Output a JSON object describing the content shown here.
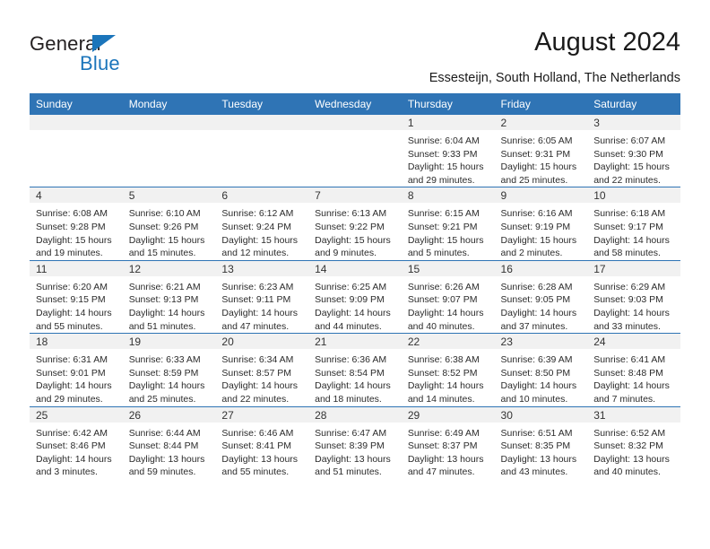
{
  "brand": {
    "name_part1": "General",
    "name_part2": "Blue",
    "accent_color": "#1b75bb"
  },
  "header": {
    "title": "August 2024",
    "subtitle": "Essesteijn, South Holland, The Netherlands"
  },
  "theme": {
    "header_row_bg": "#2f74b5",
    "daynum_bg": "#f1f1f1",
    "grid_line": "#2f74b5"
  },
  "weekdays": [
    "Sunday",
    "Monday",
    "Tuesday",
    "Wednesday",
    "Thursday",
    "Friday",
    "Saturday"
  ],
  "weeks": [
    [
      {
        "day": "",
        "sunrise": "",
        "sunset": "",
        "daylight1": "",
        "daylight2": ""
      },
      {
        "day": "",
        "sunrise": "",
        "sunset": "",
        "daylight1": "",
        "daylight2": ""
      },
      {
        "day": "",
        "sunrise": "",
        "sunset": "",
        "daylight1": "",
        "daylight2": ""
      },
      {
        "day": "",
        "sunrise": "",
        "sunset": "",
        "daylight1": "",
        "daylight2": ""
      },
      {
        "day": "1",
        "sunrise": "Sunrise: 6:04 AM",
        "sunset": "Sunset: 9:33 PM",
        "daylight1": "Daylight: 15 hours",
        "daylight2": "and 29 minutes."
      },
      {
        "day": "2",
        "sunrise": "Sunrise: 6:05 AM",
        "sunset": "Sunset: 9:31 PM",
        "daylight1": "Daylight: 15 hours",
        "daylight2": "and 25 minutes."
      },
      {
        "day": "3",
        "sunrise": "Sunrise: 6:07 AM",
        "sunset": "Sunset: 9:30 PM",
        "daylight1": "Daylight: 15 hours",
        "daylight2": "and 22 minutes."
      }
    ],
    [
      {
        "day": "4",
        "sunrise": "Sunrise: 6:08 AM",
        "sunset": "Sunset: 9:28 PM",
        "daylight1": "Daylight: 15 hours",
        "daylight2": "and 19 minutes."
      },
      {
        "day": "5",
        "sunrise": "Sunrise: 6:10 AM",
        "sunset": "Sunset: 9:26 PM",
        "daylight1": "Daylight: 15 hours",
        "daylight2": "and 15 minutes."
      },
      {
        "day": "6",
        "sunrise": "Sunrise: 6:12 AM",
        "sunset": "Sunset: 9:24 PM",
        "daylight1": "Daylight: 15 hours",
        "daylight2": "and 12 minutes."
      },
      {
        "day": "7",
        "sunrise": "Sunrise: 6:13 AM",
        "sunset": "Sunset: 9:22 PM",
        "daylight1": "Daylight: 15 hours",
        "daylight2": "and 9 minutes."
      },
      {
        "day": "8",
        "sunrise": "Sunrise: 6:15 AM",
        "sunset": "Sunset: 9:21 PM",
        "daylight1": "Daylight: 15 hours",
        "daylight2": "and 5 minutes."
      },
      {
        "day": "9",
        "sunrise": "Sunrise: 6:16 AM",
        "sunset": "Sunset: 9:19 PM",
        "daylight1": "Daylight: 15 hours",
        "daylight2": "and 2 minutes."
      },
      {
        "day": "10",
        "sunrise": "Sunrise: 6:18 AM",
        "sunset": "Sunset: 9:17 PM",
        "daylight1": "Daylight: 14 hours",
        "daylight2": "and 58 minutes."
      }
    ],
    [
      {
        "day": "11",
        "sunrise": "Sunrise: 6:20 AM",
        "sunset": "Sunset: 9:15 PM",
        "daylight1": "Daylight: 14 hours",
        "daylight2": "and 55 minutes."
      },
      {
        "day": "12",
        "sunrise": "Sunrise: 6:21 AM",
        "sunset": "Sunset: 9:13 PM",
        "daylight1": "Daylight: 14 hours",
        "daylight2": "and 51 minutes."
      },
      {
        "day": "13",
        "sunrise": "Sunrise: 6:23 AM",
        "sunset": "Sunset: 9:11 PM",
        "daylight1": "Daylight: 14 hours",
        "daylight2": "and 47 minutes."
      },
      {
        "day": "14",
        "sunrise": "Sunrise: 6:25 AM",
        "sunset": "Sunset: 9:09 PM",
        "daylight1": "Daylight: 14 hours",
        "daylight2": "and 44 minutes."
      },
      {
        "day": "15",
        "sunrise": "Sunrise: 6:26 AM",
        "sunset": "Sunset: 9:07 PM",
        "daylight1": "Daylight: 14 hours",
        "daylight2": "and 40 minutes."
      },
      {
        "day": "16",
        "sunrise": "Sunrise: 6:28 AM",
        "sunset": "Sunset: 9:05 PM",
        "daylight1": "Daylight: 14 hours",
        "daylight2": "and 37 minutes."
      },
      {
        "day": "17",
        "sunrise": "Sunrise: 6:29 AM",
        "sunset": "Sunset: 9:03 PM",
        "daylight1": "Daylight: 14 hours",
        "daylight2": "and 33 minutes."
      }
    ],
    [
      {
        "day": "18",
        "sunrise": "Sunrise: 6:31 AM",
        "sunset": "Sunset: 9:01 PM",
        "daylight1": "Daylight: 14 hours",
        "daylight2": "and 29 minutes."
      },
      {
        "day": "19",
        "sunrise": "Sunrise: 6:33 AM",
        "sunset": "Sunset: 8:59 PM",
        "daylight1": "Daylight: 14 hours",
        "daylight2": "and 25 minutes."
      },
      {
        "day": "20",
        "sunrise": "Sunrise: 6:34 AM",
        "sunset": "Sunset: 8:57 PM",
        "daylight1": "Daylight: 14 hours",
        "daylight2": "and 22 minutes."
      },
      {
        "day": "21",
        "sunrise": "Sunrise: 6:36 AM",
        "sunset": "Sunset: 8:54 PM",
        "daylight1": "Daylight: 14 hours",
        "daylight2": "and 18 minutes."
      },
      {
        "day": "22",
        "sunrise": "Sunrise: 6:38 AM",
        "sunset": "Sunset: 8:52 PM",
        "daylight1": "Daylight: 14 hours",
        "daylight2": "and 14 minutes."
      },
      {
        "day": "23",
        "sunrise": "Sunrise: 6:39 AM",
        "sunset": "Sunset: 8:50 PM",
        "daylight1": "Daylight: 14 hours",
        "daylight2": "and 10 minutes."
      },
      {
        "day": "24",
        "sunrise": "Sunrise: 6:41 AM",
        "sunset": "Sunset: 8:48 PM",
        "daylight1": "Daylight: 14 hours",
        "daylight2": "and 7 minutes."
      }
    ],
    [
      {
        "day": "25",
        "sunrise": "Sunrise: 6:42 AM",
        "sunset": "Sunset: 8:46 PM",
        "daylight1": "Daylight: 14 hours",
        "daylight2": "and 3 minutes."
      },
      {
        "day": "26",
        "sunrise": "Sunrise: 6:44 AM",
        "sunset": "Sunset: 8:44 PM",
        "daylight1": "Daylight: 13 hours",
        "daylight2": "and 59 minutes."
      },
      {
        "day": "27",
        "sunrise": "Sunrise: 6:46 AM",
        "sunset": "Sunset: 8:41 PM",
        "daylight1": "Daylight: 13 hours",
        "daylight2": "and 55 minutes."
      },
      {
        "day": "28",
        "sunrise": "Sunrise: 6:47 AM",
        "sunset": "Sunset: 8:39 PM",
        "daylight1": "Daylight: 13 hours",
        "daylight2": "and 51 minutes."
      },
      {
        "day": "29",
        "sunrise": "Sunrise: 6:49 AM",
        "sunset": "Sunset: 8:37 PM",
        "daylight1": "Daylight: 13 hours",
        "daylight2": "and 47 minutes."
      },
      {
        "day": "30",
        "sunrise": "Sunrise: 6:51 AM",
        "sunset": "Sunset: 8:35 PM",
        "daylight1": "Daylight: 13 hours",
        "daylight2": "and 43 minutes."
      },
      {
        "day": "31",
        "sunrise": "Sunrise: 6:52 AM",
        "sunset": "Sunset: 8:32 PM",
        "daylight1": "Daylight: 13 hours",
        "daylight2": "and 40 minutes."
      }
    ]
  ]
}
